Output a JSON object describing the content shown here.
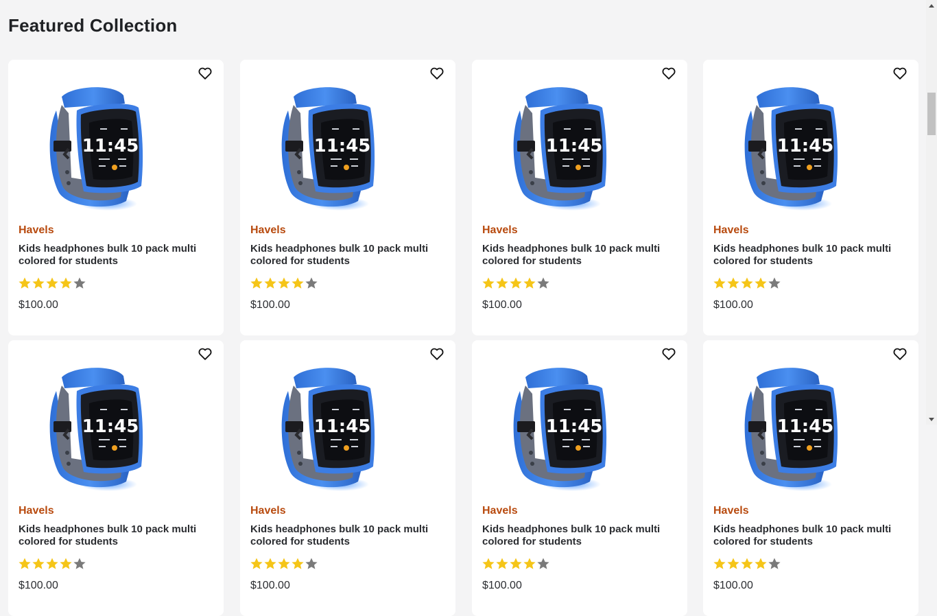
{
  "section": {
    "title": "Featured Collection"
  },
  "products": [
    {
      "brand": "Havels",
      "title": "Kids headphones bulk 10 pack multi colored for students",
      "rating": 4,
      "rating_max": 5,
      "price": "$100.00"
    },
    {
      "brand": "Havels",
      "title": "Kids headphones bulk 10 pack multi colored for students",
      "rating": 4,
      "rating_max": 5,
      "price": "$100.00"
    },
    {
      "brand": "Havels",
      "title": "Kids headphones bulk 10 pack multi colored for students",
      "rating": 4,
      "rating_max": 5,
      "price": "$100.00"
    },
    {
      "brand": "Havels",
      "title": "Kids headphones bulk 10 pack multi colored for students",
      "rating": 4,
      "rating_max": 5,
      "price": "$100.00"
    },
    {
      "brand": "Havels",
      "title": "Kids headphones bulk 10 pack multi colored for students",
      "rating": 4,
      "rating_max": 5,
      "price": "$100.00"
    },
    {
      "brand": "Havels",
      "title": "Kids headphones bulk 10 pack multi colored for students",
      "rating": 4,
      "rating_max": 5,
      "price": "$100.00"
    },
    {
      "brand": "Havels",
      "title": "Kids headphones bulk 10 pack multi colored for students",
      "rating": 4,
      "rating_max": 5,
      "price": "$100.00"
    },
    {
      "brand": "Havels",
      "title": "Kids headphones bulk 10 pack multi colored for students",
      "rating": 4,
      "rating_max": 5,
      "price": "$100.00"
    }
  ],
  "product_image": {
    "icon": "smartwatch-image",
    "time_text": "11:45"
  },
  "icons": {
    "wishlist": "heart-outline-icon",
    "star": "star-icon"
  },
  "colors": {
    "brand": "#b84a0e",
    "star_filled": "#f5c518",
    "star_empty": "#7a7a7a",
    "watch_band": "#3a7fe0",
    "background": "#f4f4f5"
  }
}
